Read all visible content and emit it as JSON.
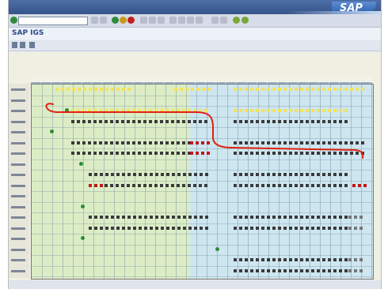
{
  "window": {
    "title": "SAP IGS"
  },
  "sap_logo": "SAP",
  "menubar_items": [],
  "colors": {
    "brand_blue": "#2b5ca8",
    "zone_green": "#dcedc6",
    "zone_blue": "#cde6ef",
    "yellow": "#f3e35a",
    "red": "#c01818",
    "dark": "#3a3a3a",
    "annotation": "#e02010"
  },
  "icons": [
    "enter-icon",
    "save-icon",
    "back-icon",
    "exit-icon",
    "cancel-icon",
    "print-icon",
    "find-icon",
    "help-icon"
  ]
}
